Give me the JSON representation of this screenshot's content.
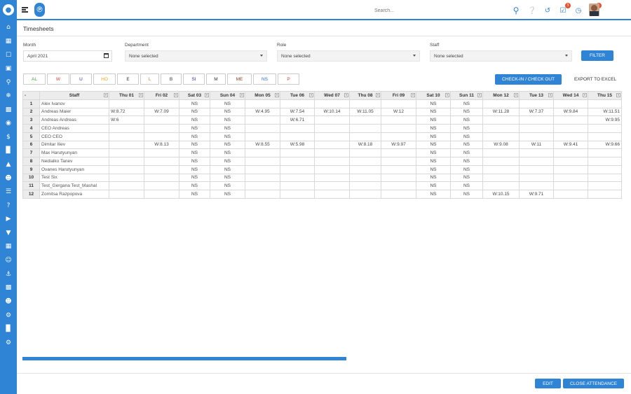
{
  "header": {
    "search_placeholder": "Search...",
    "notifications_badge": "3",
    "alerts_badge": "1"
  },
  "page": {
    "title": "Timesheets"
  },
  "filters": {
    "month_label": "Month",
    "month_value": "April 2021",
    "department_label": "Department",
    "department_value": "None selected",
    "role_label": "Role",
    "role_value": "None selected",
    "staff_label": "Staff",
    "staff_value": "None selected",
    "filter_button": "FILTER"
  },
  "legend": [
    {
      "code": "AL",
      "color": "#3aa83a"
    },
    {
      "code": "W",
      "color": "#e23b3b"
    },
    {
      "code": "U",
      "color": "#2b2bd6"
    },
    {
      "code": "HO",
      "color": "#f0a21b"
    },
    {
      "code": "E",
      "color": "#333333"
    },
    {
      "code": "L",
      "color": "#e77c1e"
    },
    {
      "code": "B",
      "color": "#333333"
    },
    {
      "code": "SI",
      "color": "#2b2bd6"
    },
    {
      "code": "M",
      "color": "#333333"
    },
    {
      "code": "ME",
      "color": "#8a3c1e"
    },
    {
      "code": "NS",
      "color": "#2b6fd6"
    },
    {
      "code": "P",
      "color": "#e23b3b"
    }
  ],
  "actions": {
    "checkin_button": "CHECK-IN / CHECK OUT",
    "export_link": "EXPORT TO EXCEL"
  },
  "table": {
    "corner": "-",
    "staff_header": "Staff",
    "columns": [
      "Thu 01",
      "Fri 02",
      "Sat 03",
      "Sun 04",
      "Mon 05",
      "Tue 06",
      "Wed 07",
      "Thu 08",
      "Fri 09",
      "Sat 10",
      "Sun 11",
      "Mon 12",
      "Tue 13",
      "Wed 14",
      "Thu 15"
    ],
    "rows": [
      {
        "idx": "1",
        "name": "Alex Ivanov",
        "cells": [
          "",
          "",
          "NS",
          "NS",
          "",
          "",
          "",
          "",
          "",
          "NS",
          "NS",
          "",
          "",
          "",
          ""
        ]
      },
      {
        "idx": "2",
        "name": "Andreas Maier",
        "cells": [
          "W:8.72",
          "W:7.09",
          "NS",
          "NS",
          "W:4.95",
          "W:7.54",
          "W:10.14",
          "W:11.05",
          "W:12",
          "NS",
          "NS",
          "W:11.28",
          "W:7.37",
          "W:9.84",
          "W:11.51"
        ]
      },
      {
        "idx": "3",
        "name": "Andreas Andreas",
        "cells": [
          "W:6",
          "",
          "NS",
          "NS",
          "",
          "W:6.71",
          "",
          "",
          "",
          "NS",
          "NS",
          "",
          "",
          "",
          "W:9.95"
        ]
      },
      {
        "idx": "4",
        "name": "CEO Andreas",
        "cells": [
          "",
          "",
          "NS",
          "NS",
          "",
          "",
          "",
          "",
          "",
          "NS",
          "NS",
          "",
          "",
          "",
          ""
        ]
      },
      {
        "idx": "5",
        "name": "CEO CEO",
        "cells": [
          "",
          "",
          "NS",
          "NS",
          "",
          "",
          "",
          "",
          "",
          "NS",
          "NS",
          "",
          "",
          "",
          ""
        ]
      },
      {
        "idx": "6",
        "name": "Dimitar Iliev",
        "cells": [
          "",
          "W:8.13",
          "NS",
          "NS",
          "W:8.55",
          "W:5.98",
          "",
          "W:8.18",
          "W:9.97",
          "NS",
          "NS",
          "W:9.08",
          "W:11",
          "W:9.41",
          "W:9.66"
        ]
      },
      {
        "idx": "7",
        "name": "Max Harutyunyan",
        "cells": [
          "",
          "",
          "NS",
          "NS",
          "",
          "",
          "",
          "",
          "",
          "NS",
          "NS",
          "",
          "",
          "",
          ""
        ]
      },
      {
        "idx": "8",
        "name": "Nedialko Tanev",
        "cells": [
          "",
          "",
          "NS",
          "NS",
          "",
          "",
          "",
          "",
          "",
          "NS",
          "NS",
          "",
          "",
          "",
          ""
        ]
      },
      {
        "idx": "9",
        "name": "Ovanes Harutyunyan",
        "cells": [
          "",
          "",
          "NS",
          "NS",
          "",
          "",
          "",
          "",
          "",
          "NS",
          "NS",
          "",
          "",
          "",
          ""
        ]
      },
      {
        "idx": "10",
        "name": "Test Six",
        "cells": [
          "",
          "",
          "NS",
          "NS",
          "",
          "",
          "",
          "",
          "",
          "NS",
          "NS",
          "",
          "",
          "",
          ""
        ]
      },
      {
        "idx": "11",
        "name": "Test_Gergana Test_Mashal",
        "cells": [
          "",
          "",
          "NS",
          "NS",
          "",
          "",
          "",
          "",
          "",
          "NS",
          "NS",
          "",
          "",
          "",
          ""
        ]
      },
      {
        "idx": "12",
        "name": "Zornitsa Razpopova",
        "cells": [
          "",
          "",
          "NS",
          "NS",
          "",
          "",
          "",
          "",
          "",
          "NS",
          "NS",
          "W:10.15",
          "W:9.71",
          "",
          ""
        ]
      }
    ]
  },
  "footer": {
    "edit_button": "EDIT",
    "close_button": "CLOSE ATTENDANCE"
  },
  "sidebar": {
    "icons": [
      "logo-icon",
      "home-icon",
      "calendar-icon",
      "lock-icon",
      "cart-icon",
      "key-icon",
      "snowflake-icon",
      "building-icon",
      "globe-icon",
      "dollar-icon",
      "bar-chart-icon",
      "bank-icon",
      "users-icon",
      "list-icon",
      "help-icon",
      "video-icon",
      "filter-icon",
      "calendar-grid-icon",
      "user-circle-icon",
      "anchor-icon",
      "id-card-icon",
      "team-icon",
      "gears-icon",
      "factory-icon",
      "settings-icon"
    ]
  }
}
